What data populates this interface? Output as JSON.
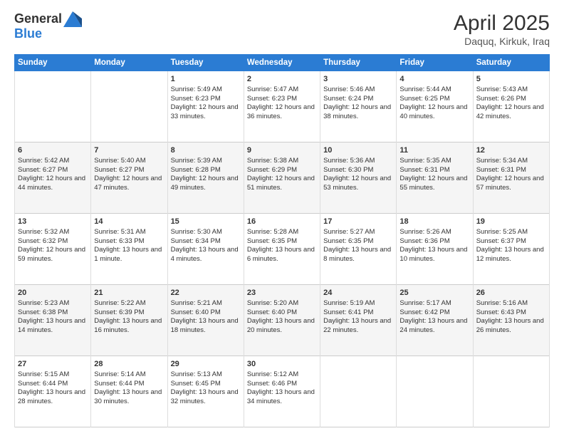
{
  "header": {
    "logo_line1": "General",
    "logo_line2": "Blue",
    "title": "April 2025",
    "subtitle": "Daquq, Kirkuk, Iraq"
  },
  "days_of_week": [
    "Sunday",
    "Monday",
    "Tuesday",
    "Wednesday",
    "Thursday",
    "Friday",
    "Saturday"
  ],
  "weeks": [
    [
      {
        "day": "",
        "sunrise": "",
        "sunset": "",
        "daylight": ""
      },
      {
        "day": "",
        "sunrise": "",
        "sunset": "",
        "daylight": ""
      },
      {
        "day": "1",
        "sunrise": "Sunrise: 5:49 AM",
        "sunset": "Sunset: 6:23 PM",
        "daylight": "Daylight: 12 hours and 33 minutes."
      },
      {
        "day": "2",
        "sunrise": "Sunrise: 5:47 AM",
        "sunset": "Sunset: 6:23 PM",
        "daylight": "Daylight: 12 hours and 36 minutes."
      },
      {
        "day": "3",
        "sunrise": "Sunrise: 5:46 AM",
        "sunset": "Sunset: 6:24 PM",
        "daylight": "Daylight: 12 hours and 38 minutes."
      },
      {
        "day": "4",
        "sunrise": "Sunrise: 5:44 AM",
        "sunset": "Sunset: 6:25 PM",
        "daylight": "Daylight: 12 hours and 40 minutes."
      },
      {
        "day": "5",
        "sunrise": "Sunrise: 5:43 AM",
        "sunset": "Sunset: 6:26 PM",
        "daylight": "Daylight: 12 hours and 42 minutes."
      }
    ],
    [
      {
        "day": "6",
        "sunrise": "Sunrise: 5:42 AM",
        "sunset": "Sunset: 6:27 PM",
        "daylight": "Daylight: 12 hours and 44 minutes."
      },
      {
        "day": "7",
        "sunrise": "Sunrise: 5:40 AM",
        "sunset": "Sunset: 6:27 PM",
        "daylight": "Daylight: 12 hours and 47 minutes."
      },
      {
        "day": "8",
        "sunrise": "Sunrise: 5:39 AM",
        "sunset": "Sunset: 6:28 PM",
        "daylight": "Daylight: 12 hours and 49 minutes."
      },
      {
        "day": "9",
        "sunrise": "Sunrise: 5:38 AM",
        "sunset": "Sunset: 6:29 PM",
        "daylight": "Daylight: 12 hours and 51 minutes."
      },
      {
        "day": "10",
        "sunrise": "Sunrise: 5:36 AM",
        "sunset": "Sunset: 6:30 PM",
        "daylight": "Daylight: 12 hours and 53 minutes."
      },
      {
        "day": "11",
        "sunrise": "Sunrise: 5:35 AM",
        "sunset": "Sunset: 6:31 PM",
        "daylight": "Daylight: 12 hours and 55 minutes."
      },
      {
        "day": "12",
        "sunrise": "Sunrise: 5:34 AM",
        "sunset": "Sunset: 6:31 PM",
        "daylight": "Daylight: 12 hours and 57 minutes."
      }
    ],
    [
      {
        "day": "13",
        "sunrise": "Sunrise: 5:32 AM",
        "sunset": "Sunset: 6:32 PM",
        "daylight": "Daylight: 12 hours and 59 minutes."
      },
      {
        "day": "14",
        "sunrise": "Sunrise: 5:31 AM",
        "sunset": "Sunset: 6:33 PM",
        "daylight": "Daylight: 13 hours and 1 minute."
      },
      {
        "day": "15",
        "sunrise": "Sunrise: 5:30 AM",
        "sunset": "Sunset: 6:34 PM",
        "daylight": "Daylight: 13 hours and 4 minutes."
      },
      {
        "day": "16",
        "sunrise": "Sunrise: 5:28 AM",
        "sunset": "Sunset: 6:35 PM",
        "daylight": "Daylight: 13 hours and 6 minutes."
      },
      {
        "day": "17",
        "sunrise": "Sunrise: 5:27 AM",
        "sunset": "Sunset: 6:35 PM",
        "daylight": "Daylight: 13 hours and 8 minutes."
      },
      {
        "day": "18",
        "sunrise": "Sunrise: 5:26 AM",
        "sunset": "Sunset: 6:36 PM",
        "daylight": "Daylight: 13 hours and 10 minutes."
      },
      {
        "day": "19",
        "sunrise": "Sunrise: 5:25 AM",
        "sunset": "Sunset: 6:37 PM",
        "daylight": "Daylight: 13 hours and 12 minutes."
      }
    ],
    [
      {
        "day": "20",
        "sunrise": "Sunrise: 5:23 AM",
        "sunset": "Sunset: 6:38 PM",
        "daylight": "Daylight: 13 hours and 14 minutes."
      },
      {
        "day": "21",
        "sunrise": "Sunrise: 5:22 AM",
        "sunset": "Sunset: 6:39 PM",
        "daylight": "Daylight: 13 hours and 16 minutes."
      },
      {
        "day": "22",
        "sunrise": "Sunrise: 5:21 AM",
        "sunset": "Sunset: 6:40 PM",
        "daylight": "Daylight: 13 hours and 18 minutes."
      },
      {
        "day": "23",
        "sunrise": "Sunrise: 5:20 AM",
        "sunset": "Sunset: 6:40 PM",
        "daylight": "Daylight: 13 hours and 20 minutes."
      },
      {
        "day": "24",
        "sunrise": "Sunrise: 5:19 AM",
        "sunset": "Sunset: 6:41 PM",
        "daylight": "Daylight: 13 hours and 22 minutes."
      },
      {
        "day": "25",
        "sunrise": "Sunrise: 5:17 AM",
        "sunset": "Sunset: 6:42 PM",
        "daylight": "Daylight: 13 hours and 24 minutes."
      },
      {
        "day": "26",
        "sunrise": "Sunrise: 5:16 AM",
        "sunset": "Sunset: 6:43 PM",
        "daylight": "Daylight: 13 hours and 26 minutes."
      }
    ],
    [
      {
        "day": "27",
        "sunrise": "Sunrise: 5:15 AM",
        "sunset": "Sunset: 6:44 PM",
        "daylight": "Daylight: 13 hours and 28 minutes."
      },
      {
        "day": "28",
        "sunrise": "Sunrise: 5:14 AM",
        "sunset": "Sunset: 6:44 PM",
        "daylight": "Daylight: 13 hours and 30 minutes."
      },
      {
        "day": "29",
        "sunrise": "Sunrise: 5:13 AM",
        "sunset": "Sunset: 6:45 PM",
        "daylight": "Daylight: 13 hours and 32 minutes."
      },
      {
        "day": "30",
        "sunrise": "Sunrise: 5:12 AM",
        "sunset": "Sunset: 6:46 PM",
        "daylight": "Daylight: 13 hours and 34 minutes."
      },
      {
        "day": "",
        "sunrise": "",
        "sunset": "",
        "daylight": ""
      },
      {
        "day": "",
        "sunrise": "",
        "sunset": "",
        "daylight": ""
      },
      {
        "day": "",
        "sunrise": "",
        "sunset": "",
        "daylight": ""
      }
    ]
  ]
}
